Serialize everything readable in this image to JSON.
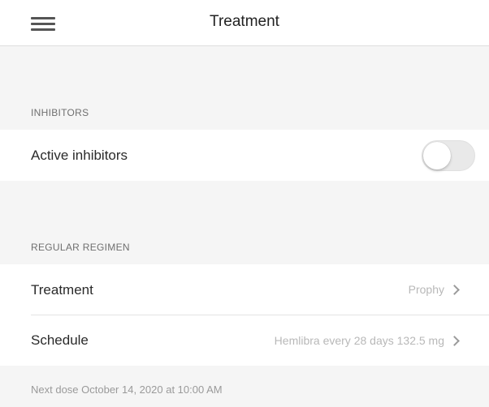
{
  "navbar": {
    "title": "Treatment",
    "menu_icon": "hamburger-menu-icon"
  },
  "inhibitors": {
    "header": "INHIBITORS",
    "active_label": "Active inhibitors",
    "active_on": false
  },
  "regimen": {
    "header": "REGULAR REGIMEN",
    "rows": [
      {
        "label": "Treatment",
        "value": "Prophy",
        "icon": "chevron-right-icon"
      },
      {
        "label": "Schedule",
        "value": "Hemlibra every 28 days 132.5 mg",
        "icon": "chevron-right-icon"
      }
    ],
    "next_dose": "Next dose October 14, 2020 at 10:00 AM"
  },
  "colors": {
    "background": "#f5f5f5",
    "row_background": "#ffffff",
    "secondary_text": "#b8b8b8",
    "header_text": "#6f6f6f"
  }
}
